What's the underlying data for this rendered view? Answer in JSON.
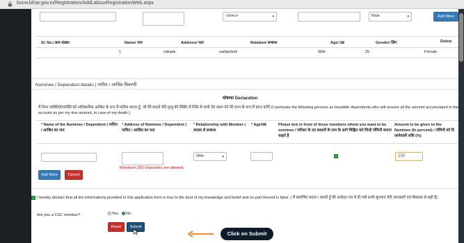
{
  "browser": {
    "url": "bocw.bihar.gov.in/Registration/AddLabourRegistrationWeb.aspx"
  },
  "top_form": {
    "select_placeholder": "-Select-",
    "gender_value": "Male",
    "add_more_label": "Add More"
  },
  "member_table": {
    "headers": [
      "Sl. No./ क्रम संख्या",
      "Name/ नाम",
      "Address/ पता",
      "Relation/ सम्बन्ध",
      "Age/ उम्र",
      "Gender/ लिंग",
      "Delete"
    ],
    "row": [
      "1",
      "sdsqds",
      "sadqsdsds",
      "Wife",
      "25",
      "Female"
    ]
  },
  "nominee": {
    "section_title": "Nominee / Dependent details | नामित / आश्रित विवरणी",
    "declaration_title": "घोषणा/ Declaration",
    "declaration_text": "मैं निम्न व्यक्तियों/व्यक्ति को अधिकारिक आश्रित के रूप में नामित करता हूँ, जो मेरे बादले मेरी मृत्यु की स्थिति में निधि से सभी देय रकम को मेरे लाभ के रूप में प्राप्त करेंगे (I nominate the following persons as bonafide dependents who will receive all the amount accumulated in the account as per my due amount, in case of my death.)",
    "columns": [
      "* Name of the Nominee / Dependent | नामित / आश्रित का नाम",
      "* Address of Nominee / Dependent | नामित / आश्रित का पता",
      "* Relationship with Member | सदस्य से सम्बन्ध",
      "* Age/उम्र",
      "Please tick in front of those members whom you want to be nominee / परिवार के उन सदस्यों के नाम के आगे चिह्नित करे जिन्हें नॉमिनी बनाना चाहते है",
      "Amount to be given to the Nominee (In percent) / नॉमिनी को दि जानेवाली राशि (%)"
    ],
    "relation_value": "Wife",
    "amount_value": "100",
    "address_warning": "Maximum 250 characters are allowed.",
    "add_more_label": "Add More",
    "cancel_label": "Cancel"
  },
  "agreement": {
    "text": "I hereby declare that all the informations provided in this application form is true to the best of my knowledge and belief and no part thereof is false. ( मैं प्रमाणित करता / करती हूँ की आवेदन पत्र में दी गयी सभी सूचनाएं मेरी जानकारी एवं विश्वास से सही है)",
    "csc_question": "Are you a CSC member?",
    "yes_label": "Yes",
    "no_label": "No",
    "reset_label": "Reset",
    "submit_label": "Submit"
  },
  "annotation": {
    "callout_text": "Click on Submit",
    "accent": "#f28c28"
  },
  "colors": {
    "primary": "#337ab7",
    "danger": "#c9302c",
    "submit": "#1f4e79",
    "checked": "#2ea44f"
  }
}
